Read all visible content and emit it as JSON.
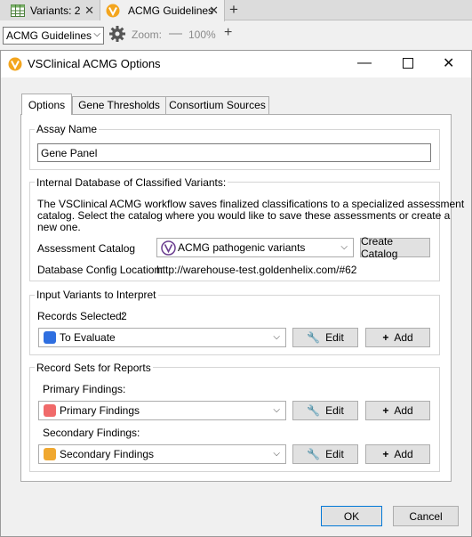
{
  "window_tabs": [
    {
      "label": "Variants: 2",
      "icon": "table-icon"
    },
    {
      "label": "ACMG Guidelines",
      "icon": "vs-logo-icon"
    }
  ],
  "toolbar": {
    "view_select": "ACMG Guidelines",
    "zoom_label": "Zoom:",
    "zoom_value": "100%"
  },
  "dialog": {
    "title": "VSClinical ACMG Options",
    "tabs": [
      "Options",
      "Gene Thresholds",
      "Consortium Sources"
    ],
    "assay": {
      "group_title": "Assay Name",
      "value": "Gene Panel"
    },
    "catalog": {
      "group_title": "Internal Database of Classified Variants:",
      "desc_lines": [
        "The VSClinical ACMG workflow saves finalized classifications to a specialized assessment",
        "catalog. Select the catalog where you would like to save these assessments or create a",
        "new one."
      ],
      "assessment_label": "Assessment Catalog",
      "assessment_value": "ACMG pathogenic variants",
      "create_button": "Create Catalog",
      "config_label": "Database Config Location:",
      "config_value": "http://warehouse-test.goldenhelix.com/#62"
    },
    "input_variants": {
      "group_title": "Input Variants to Interpret",
      "records_label": "Records Selected:",
      "records_value": "2",
      "selection": "To Evaluate",
      "selection_color": "#2f6fe0"
    },
    "record_sets": {
      "group_title": "Record Sets for Reports",
      "primary_label": "Primary Findings:",
      "primary_value": "Primary Findings",
      "primary_color": "#f06a6a",
      "secondary_label": "Secondary Findings:",
      "secondary_value": "Secondary Findings",
      "secondary_color": "#f0a830"
    },
    "edit_label": "Edit",
    "add_label": "Add",
    "ok_label": "OK",
    "cancel_label": "Cancel"
  }
}
